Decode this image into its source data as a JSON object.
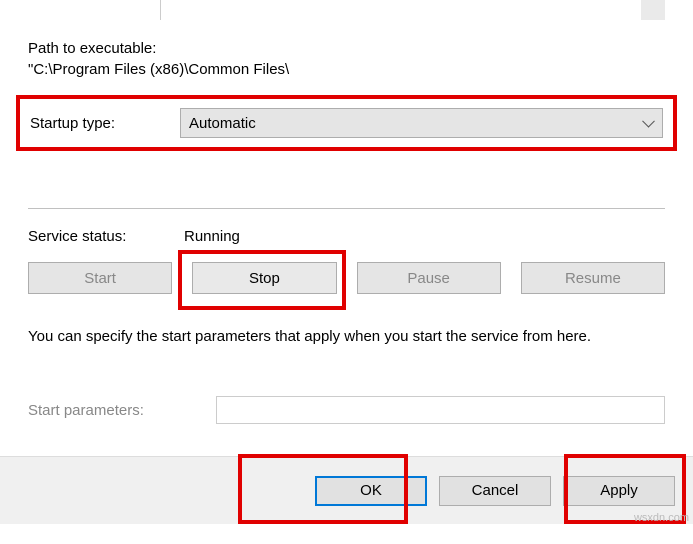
{
  "path": {
    "label": "Path to executable:",
    "value": "\"C:\\Program Files (x86)\\Common Files\\"
  },
  "startup": {
    "label": "Startup type:",
    "selected": "Automatic"
  },
  "service_status": {
    "label": "Service status:",
    "value": "Running"
  },
  "buttons": {
    "start": "Start",
    "stop": "Stop",
    "pause": "Pause",
    "resume": "Resume"
  },
  "specify_text": "You can specify the start parameters that apply when you start the service from here.",
  "start_params": {
    "label": "Start parameters:",
    "value": ""
  },
  "footer": {
    "ok": "OK",
    "cancel": "Cancel",
    "apply": "Apply"
  },
  "watermark": "wsxdn.com"
}
